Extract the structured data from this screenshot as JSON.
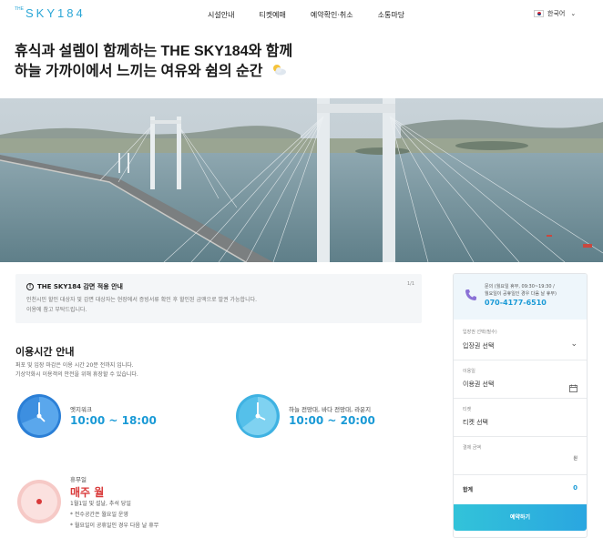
{
  "header": {
    "logo_small": "THE",
    "logo_main": "SKY184",
    "nav": [
      "시설안내",
      "티켓예매",
      "예약확인·취소",
      "소통마당"
    ],
    "language": "한국어"
  },
  "headline": {
    "line1": "휴식과 설렘이 함께하는 THE SKY184와 함께",
    "line2": "하늘 가까이에서 느끼는 여유와 쉼의 순간"
  },
  "notice": {
    "title": "THE SKY184 감면 적용 안내",
    "pager": "1/1",
    "line1": "인천시민 할인 대상자 및 감면 대상자는 현장에서 증빙서류 확인 후 할인된 금액으로 발권 가능합니다.",
    "line2": "이용에 참고 부탁드립니다."
  },
  "hours": {
    "title": "이용시간 안내",
    "desc1": "퍼포 및 입장 마감은 이용 시간 20분 전까지 입니다.",
    "desc2": "기상악화시 이용객의 안전을 위해 휴장할 수 있습니다.",
    "items": [
      {
        "label": "엣지워크",
        "time": "10:00 ~ 18:00"
      },
      {
        "label": "하늘 전망대, 바다 전망대, 라운지",
        "time": "10:00 ~ 20:00"
      }
    ],
    "closed": {
      "label": "휴무일",
      "value": "매주 월",
      "notes": [
        "1월1일 및 설날, 추석 당일",
        "* 전수공간은 월요일 운영",
        "* 월요일이 공휴일인 경우 다음 날 휴무"
      ]
    }
  },
  "booking": {
    "contact_line1": "문의 (월요일 휴무, 09:30~19:30 /",
    "contact_line2": "월요일이 공휴일인 경우 다음 날 휴무)",
    "phone": "070-4177-6510",
    "fields": [
      {
        "label": "입장권 선택(필수)",
        "value": "입장권 선택"
      },
      {
        "label": "이용일",
        "value": "이용권 선택"
      },
      {
        "label": "티켓",
        "value": "티켓 선택"
      },
      {
        "label": "결제 금액",
        "value": "원"
      }
    ],
    "total_label": "합계",
    "total_value": "0",
    "button": "예약하기"
  },
  "colors": {
    "accent": "#1a9ad6",
    "closed": "#d93a3a",
    "button_start": "#32c3d9",
    "button_end": "#2aa6e0"
  }
}
